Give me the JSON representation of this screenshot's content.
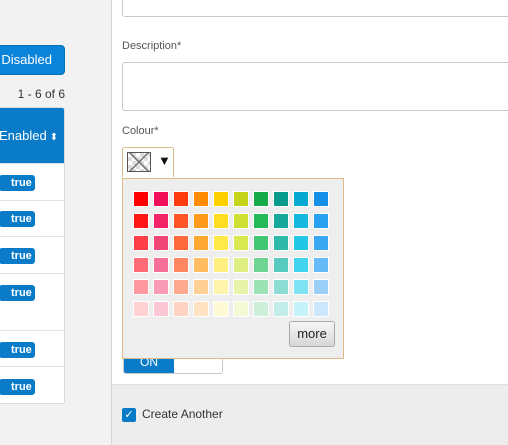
{
  "left_panel": {
    "disabled_button": "Disabled",
    "pager_text": "1 - 6 of 6",
    "table": {
      "header": "Enabled",
      "sort_icon": "sort-icon",
      "rows": [
        "true",
        "true",
        "true",
        "true",
        "true",
        "true"
      ]
    }
  },
  "form": {
    "description_label": "Description*",
    "colour_label": "Colour*",
    "toggle_on_label": "ON"
  },
  "colour_picker": {
    "selected_icon": "no-colour-icon",
    "dropdown_icon": "caret-down-icon",
    "more_label": "more",
    "palette": [
      [
        "#ff0000",
        "#f20f5a",
        "#ff3b10",
        "#ff8c00",
        "#ffd000",
        "#c7d51a",
        "#16aa49",
        "#069b8a",
        "#07a9d1",
        "#168fe8"
      ],
      [
        "#ff1717",
        "#f22366",
        "#ff5428",
        "#ff9a1a",
        "#ffdd22",
        "#cde033",
        "#23b858",
        "#16a89a",
        "#17b8dd",
        "#28a2f0"
      ],
      [
        "#ff3f48",
        "#f24678",
        "#ff6a3c",
        "#ffa831",
        "#ffe84a",
        "#d8e851",
        "#43c673",
        "#2eb9a9",
        "#22c7e6",
        "#3aa7f3"
      ],
      [
        "#ff6b77",
        "#f57099",
        "#ff8863",
        "#ffbc61",
        "#ffef80",
        "#e0ef83",
        "#6dd492",
        "#57cbbf",
        "#42d4ee",
        "#66baf6"
      ],
      [
        "#ff999f",
        "#f89bb6",
        "#ffa98f",
        "#ffcf93",
        "#fff4ab",
        "#e9f4ab",
        "#9ce2b5",
        "#8cdcd3",
        "#7fe3f3",
        "#9ad0f8"
      ],
      [
        "#ffd1d3",
        "#fcc8d6",
        "#ffd3c2",
        "#ffe3c2",
        "#fffad6",
        "#f4fad6",
        "#ccefd9",
        "#c3ede8",
        "#c6f3f9",
        "#cce6fb"
      ]
    ]
  },
  "footer": {
    "create_another_label": "Create Another",
    "create_another_checked": true,
    "check_icon": "check-icon"
  },
  "colors": {
    "primary": "#0a7bc9",
    "palette_border": "#e0b98a"
  }
}
